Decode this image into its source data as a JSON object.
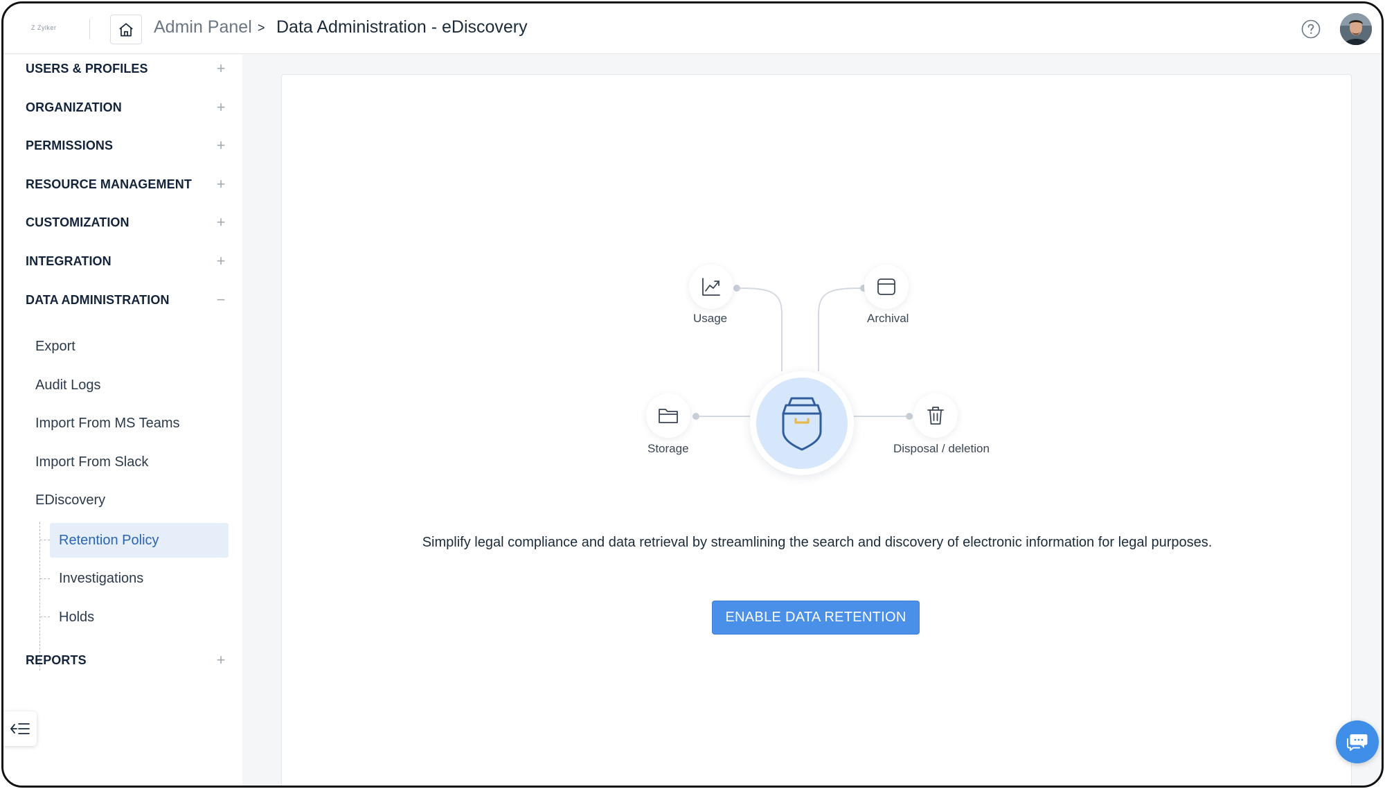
{
  "header": {
    "logo_text": "Zylker",
    "breadcrumb_root": "Admin Panel",
    "breadcrumb_separator": ">",
    "breadcrumb_current": "Data Administration - eDiscovery"
  },
  "sidebar": {
    "sections": [
      {
        "label": "USERS & PROFILES",
        "toggle": "+"
      },
      {
        "label": "ORGANIZATION",
        "toggle": "+"
      },
      {
        "label": "PERMISSIONS",
        "toggle": "+"
      },
      {
        "label": "RESOURCE MANAGEMENT",
        "toggle": "+"
      },
      {
        "label": "CUSTOMIZATION",
        "toggle": "+"
      },
      {
        "label": "INTEGRATION",
        "toggle": "+"
      },
      {
        "label": "DATA ADMINISTRATION",
        "toggle": "−"
      }
    ],
    "data_admin_items": [
      "Export",
      "Audit Logs",
      "Import From MS Teams",
      "Import From Slack",
      "EDiscovery"
    ],
    "ediscovery_children": [
      "Retention Policy",
      "Investigations",
      "Holds"
    ],
    "active_item": "Retention Policy",
    "reports": {
      "label": "REPORTS",
      "toggle": "+"
    }
  },
  "main": {
    "diagram": {
      "nodes": [
        {
          "label": "Usage",
          "icon": "chart-line-icon"
        },
        {
          "label": "Archival",
          "icon": "archive-box-icon"
        },
        {
          "label": "Storage",
          "icon": "folder-icon"
        },
        {
          "label": "Disposal / deletion",
          "icon": "trash-icon"
        }
      ],
      "center_icon": "retention-shield-icon"
    },
    "description": "Simplify legal compliance and data retrieval by streamlining the search and discovery of electronic information for legal purposes.",
    "cta_label": "ENABLE DATA RETENTION"
  },
  "colors": {
    "accent": "#4a90e8",
    "active_bg": "#e6eef9",
    "active_text": "#2a64b4",
    "shield_stroke": "#2f5d9e",
    "shield_highlight": "#e9b84a"
  }
}
